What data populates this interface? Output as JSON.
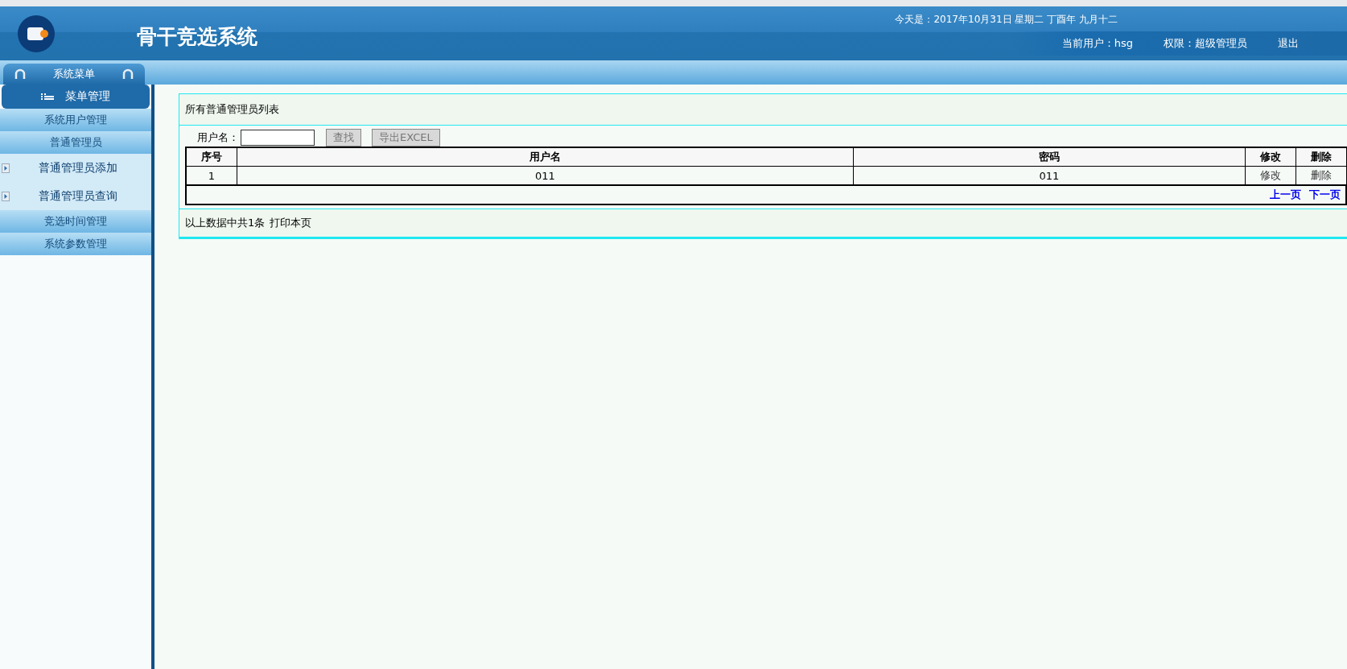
{
  "header": {
    "title": "骨干竞选系统",
    "date": "今天是：2017年10月31日 星期二 丁酉年 九月十二",
    "user": "当前用户：hsg",
    "role": "权限：超级管理员",
    "logout": "退出"
  },
  "sidebar": {
    "title": "系统菜单",
    "section": "菜单管理",
    "items": [
      {
        "kind": "group",
        "label": "系统用户管理"
      },
      {
        "kind": "group",
        "label": "普通管理员"
      },
      {
        "kind": "link",
        "label": "普通管理员添加"
      },
      {
        "kind": "link",
        "label": "普通管理员查询"
      },
      {
        "kind": "group",
        "label": "竞选时间管理"
      },
      {
        "kind": "group",
        "label": "系统参数管理"
      }
    ]
  },
  "panel": {
    "title": "所有普通管理员列表",
    "search": {
      "label": "用户名：",
      "buttons": [
        "查找",
        "导出EXCEL"
      ]
    },
    "table": {
      "columns": [
        "序号",
        "用户名",
        "密码",
        "修改",
        "删除"
      ],
      "rows": [
        {
          "cells": [
            "1",
            "011",
            "011"
          ],
          "actions": [
            "修改",
            "删除"
          ]
        }
      ]
    },
    "pager": [
      "上一页",
      "下一页"
    ],
    "footer": {
      "summary": "以上数据中共1条",
      "print": "打印本页"
    }
  }
}
